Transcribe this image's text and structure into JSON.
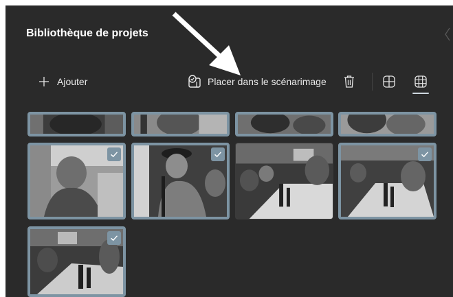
{
  "panel": {
    "title": "Bibliothèque de projets"
  },
  "toolbar": {
    "add_label": "Ajouter",
    "place_label": "Placer dans le scénarimage",
    "add_icon": "plus-icon",
    "place_icon": "storyboard-place-icon",
    "delete_icon": "trash-icon",
    "large_grid_icon": "grid-large-icon",
    "small_grid_icon": "grid-small-icon",
    "active_view": "small-grid"
  },
  "media": {
    "items": [
      {
        "id": 1,
        "selected": true,
        "visible": "partial-top"
      },
      {
        "id": 2,
        "selected": true,
        "visible": "partial-top"
      },
      {
        "id": 3,
        "selected": true,
        "visible": "partial-top"
      },
      {
        "id": 4,
        "selected": true,
        "visible": "partial-top"
      },
      {
        "id": 5,
        "selected": true
      },
      {
        "id": 6,
        "selected": true
      },
      {
        "id": 7,
        "selected": false
      },
      {
        "id": 8,
        "selected": true
      },
      {
        "id": 9,
        "selected": true,
        "visible": "partial-bottom"
      }
    ]
  },
  "colors": {
    "panel_bg": "#2a2a2a",
    "selection_accent": "#7d94a3",
    "text": "#e8e8e8",
    "annotation_arrow": "#ffffff"
  }
}
